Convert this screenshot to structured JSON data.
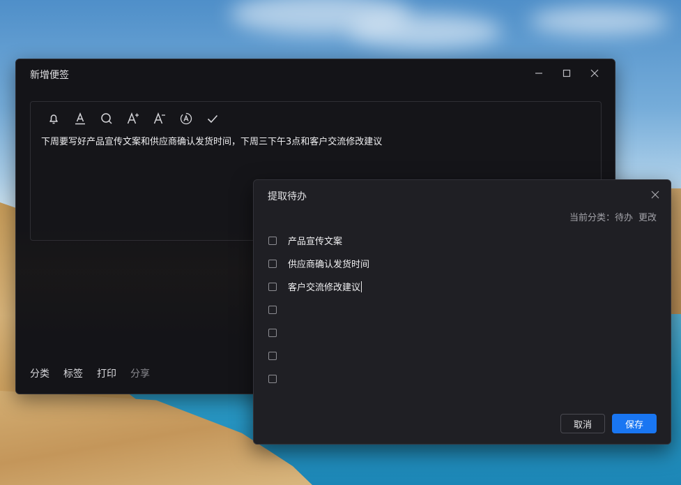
{
  "main_window": {
    "title": "新增便签",
    "controls": [
      "minimize",
      "maximize",
      "close"
    ],
    "toolbar": {
      "icons": [
        "bell-icon",
        "text-color-icon",
        "search-icon",
        "font-increase-icon",
        "font-decrease-icon",
        "spellcheck-icon",
        "checkmark-icon"
      ]
    },
    "note_text": "下周要写好产品宣传文案和供应商确认发货时间，下周三下午3点和客户交流修改建议",
    "bottom_actions": [
      {
        "label": "分类"
      },
      {
        "label": "标签"
      },
      {
        "label": "打印"
      },
      {
        "label": "分享"
      }
    ]
  },
  "dialog": {
    "title": "提取待办",
    "category_label": "当前分类：待办",
    "change_label": "更改",
    "todos": [
      {
        "text": "产品宣传文案",
        "checked": false
      },
      {
        "text": "供应商确认发货时间",
        "checked": false
      },
      {
        "text": "客户交流修改建议",
        "checked": false,
        "editing": true
      },
      {
        "text": "",
        "checked": false
      },
      {
        "text": "",
        "checked": false
      },
      {
        "text": "",
        "checked": false
      },
      {
        "text": "",
        "checked": false
      }
    ],
    "cancel_label": "取消",
    "save_label": "保存"
  },
  "colors": {
    "primary": "#1976f2",
    "window_bg": "#141418",
    "dialog_bg": "#1f1f24"
  }
}
